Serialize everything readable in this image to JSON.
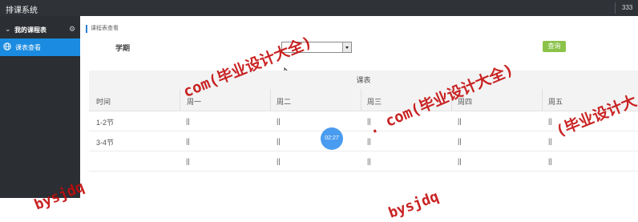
{
  "topbar": {
    "title": "排课系统",
    "user": "333"
  },
  "sidebar": {
    "group": {
      "label": "我的课程表",
      "icon": "chevron-down-icon",
      "settings_icon": "gear-icon"
    },
    "items": [
      {
        "label": "课表查看",
        "icon": "globe-icon",
        "active": true
      }
    ]
  },
  "breadcrumb": "课程表查看",
  "filter": {
    "term_label": "学期",
    "term_value": "",
    "query_label": "查询"
  },
  "schedule": {
    "caption": "课表",
    "headers": [
      "时间",
      "周一",
      "周二",
      "周三",
      "周四",
      "周五"
    ],
    "rows": [
      {
        "time": "1-2节",
        "cells": [
          "||",
          "||",
          "||",
          "||",
          "||"
        ]
      },
      {
        "time": "3-4节",
        "cells": [
          "||",
          "||",
          "||",
          "||",
          "||"
        ]
      },
      {
        "time": "",
        "cells": [
          "||",
          "||",
          "||",
          "||",
          "||"
        ]
      }
    ]
  },
  "overlay": {
    "timer": "02:27"
  },
  "watermark": {
    "line1": "com(毕业设计大全)",
    "line2": ". com(毕业设计大全)",
    "line3": "bysjdq",
    "line4": "bysjdq",
    "line5": "(毕业设计大"
  },
  "colors": {
    "topbar": "#2f3237",
    "sidebar": "#2b2e33",
    "active_item": "#1a8be0",
    "query_button": "#8bc34a",
    "watermark": "#c40c0c",
    "timer": "#4a9cf0"
  }
}
